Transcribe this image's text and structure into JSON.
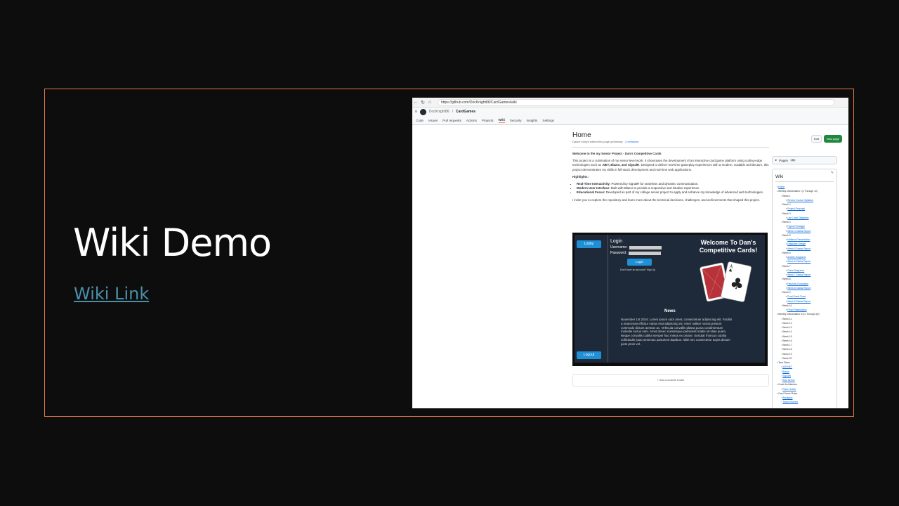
{
  "slide": {
    "title": "Wiki Demo",
    "link_text": "Wiki Link",
    "accent": "#e07a4a"
  },
  "browser": {
    "url": "https://github.com/DocKnight86/CardGames/wiki",
    "back_icon": "back-arrow-icon",
    "reload_icon": "reload-icon",
    "home_icon": "home-icon"
  },
  "github": {
    "owner": "DocKnight86",
    "separator": "/",
    "repo": "CardGames",
    "tabs": [
      "Code",
      "Issues",
      "Pull requests",
      "Actions",
      "Projects",
      "Wiki",
      "Security",
      "Insights",
      "Settings"
    ],
    "active_tab": "Wiki"
  },
  "page": {
    "title": "Home",
    "meta_prefix": "Daniel Knight edited this page yesterday ·",
    "revisions": "2 revisions",
    "edit": "Edit",
    "new_page": "New page",
    "heading": "Welcome to the my Senior Project - Dan's Competitive Cards",
    "intro_1": "This project is a culmination of my senior-level work. It showcases the development of an interactive card game platform using cutting-edge technologies such as",
    "intro_tech": ".NET, Blazor, and SignalR",
    "intro_2": ". Designed to deliver real-time gameplay experiences with a modern, scalable architecture, this project demonstrates my skills in full-stack development and real-time web applications.",
    "highlights_label": "Highlights:",
    "highlights": [
      {
        "label": "Real-Time Interactivity:",
        "text": " Powered by SignalR for seamless and dynamic communication."
      },
      {
        "label": "Modern User Interface:",
        "text": " Built with Blazor to provide a responsive and intuitive experience."
      },
      {
        "label": "Educational Focus:",
        "text": " Developed as part of my college senior project to apply and enhance my knowledge of advanced web technologies."
      }
    ],
    "closing": "I invite you to explore the repository and learn more about the technical decisions, challenges, and achievements that shaped this project.",
    "footer": "+  Add a custom footer"
  },
  "app": {
    "lobby": "Lobby",
    "logout": "Logout",
    "login_title": "Login",
    "username_label": "Username:",
    "password_label": "Password:",
    "login_button": "Login",
    "signup": "Don't have an account? Sign Up",
    "welcome": "Welcome To Dan's Competitive Cards!",
    "news_title": "News",
    "news_text": "November 1st 2024: Lorem ipsum odor amet, consectetuer adipiscing elit. Facilisi a maecenas efficitur varius erat adipiscing mi. Amet nullam nostra pretium commodo dictum aenean ac. Vehicula convallis platea purus condimentum molestie luctus nam. Amet donec scelerisque parturient mattis sit vitae quam. Neque convallis cubilia semper hac metus ex ornare. Suscipit rhoncus cubilia sollicitudin justo senectus parturient dapibus. Nibh nec consectetur turpis dictum justo proin vel."
  },
  "sidebar": {
    "pages_label": "Pages",
    "pages_count": "28",
    "wiki_title": "Wiki",
    "toc": [
      {
        "t": "Home",
        "lvl": 0,
        "link": true
      },
      {
        "t": "Weekly Deliverables I (1 Through 10)",
        "lvl": 0,
        "link": false
      },
      {
        "t": "Week 1",
        "lvl": 1,
        "link": false
      },
      {
        "t": "Review Course Syllabus",
        "lvl": 2,
        "link": true
      },
      {
        "t": "Week 2",
        "lvl": 1,
        "link": false
      },
      {
        "t": "Project Proposal",
        "lvl": 2,
        "link": true
      },
      {
        "t": "Week 3",
        "lvl": 1,
        "link": false
      },
      {
        "t": "Use Case Diagrams",
        "lvl": 2,
        "link": true
      },
      {
        "t": "Week 4",
        "lvl": 1,
        "link": false
      },
      {
        "t": "Figma Prototype",
        "lvl": 2,
        "link": true
      },
      {
        "t": "Week 4 Status Report",
        "lvl": 2,
        "link": true
      },
      {
        "t": "Week 5",
        "lvl": 1,
        "link": false
      },
      {
        "t": "Midterm Presentation",
        "lvl": 2,
        "link": true
      },
      {
        "t": "Database Design",
        "lvl": 2,
        "link": true
      },
      {
        "t": "Week 5 Status Report",
        "lvl": 2,
        "link": true
      },
      {
        "t": "Week 6",
        "lvl": 1,
        "link": false
      },
      {
        "t": "Activity Diagrams",
        "lvl": 2,
        "link": true
      },
      {
        "t": "Week 6 Status Report",
        "lvl": 2,
        "link": true
      },
      {
        "t": "Week 7",
        "lvl": 1,
        "link": false
      },
      {
        "t": "Class Diagrams",
        "lvl": 2,
        "link": true
      },
      {
        "t": "Week 7 Status Report",
        "lvl": 2,
        "link": true
      },
      {
        "t": "Week 8",
        "lvl": 1,
        "link": false
      },
      {
        "t": "Heuristic Evaluation",
        "lvl": 2,
        "link": true
      },
      {
        "t": "Week 8 Status Report",
        "lvl": 2,
        "link": true
      },
      {
        "t": "Week 9",
        "lvl": 1,
        "link": false
      },
      {
        "t": "Final Gantt Chart",
        "lvl": 2,
        "link": true
      },
      {
        "t": "Week 9 Status Report",
        "lvl": 2,
        "link": true
      },
      {
        "t": "Week 10",
        "lvl": 1,
        "link": false
      },
      {
        "t": "Final Presentation",
        "lvl": 2,
        "link": true
      },
      {
        "t": "Weekly Deliverables II (11 Through 20)",
        "lvl": 0,
        "link": false
      },
      {
        "t": "Week 11",
        "lvl": 1,
        "link": false
      },
      {
        "t": "Week 12",
        "lvl": 1,
        "link": false
      },
      {
        "t": "Week 13",
        "lvl": 1,
        "link": false
      },
      {
        "t": "Week 14",
        "lvl": 1,
        "link": false
      },
      {
        "t": "Week 15",
        "lvl": 1,
        "link": false
      },
      {
        "t": "Week 16",
        "lvl": 1,
        "link": false
      },
      {
        "t": "Week 17",
        "lvl": 1,
        "link": false
      },
      {
        "t": "Week 18",
        "lvl": 1,
        "link": false
      },
      {
        "t": "Week 19",
        "lvl": 1,
        "link": false
      },
      {
        "t": "Week 20",
        "lvl": 1,
        "link": false
      },
      {
        "t": "Tech Stack",
        "lvl": 0,
        "link": false
      },
      {
        "t": "ASP.NET",
        "lvl": 1,
        "link": true
      },
      {
        "t": "Blazor",
        "lvl": 1,
        "link": true
      },
      {
        "t": "SignalR",
        "lvl": 1,
        "link": true
      },
      {
        "t": "SQL Server",
        "lvl": 1,
        "link": true
      },
      {
        "t": "Code Architecture",
        "lvl": 0,
        "link": false
      },
      {
        "t": "Place Holder",
        "lvl": 1,
        "link": true
      },
      {
        "t": "Card Game Rules",
        "lvl": 0,
        "link": false
      },
      {
        "t": "Blackjack",
        "lvl": 1,
        "link": true
      },
      {
        "t": "Texas Hold'em",
        "lvl": 1,
        "link": true
      }
    ]
  }
}
